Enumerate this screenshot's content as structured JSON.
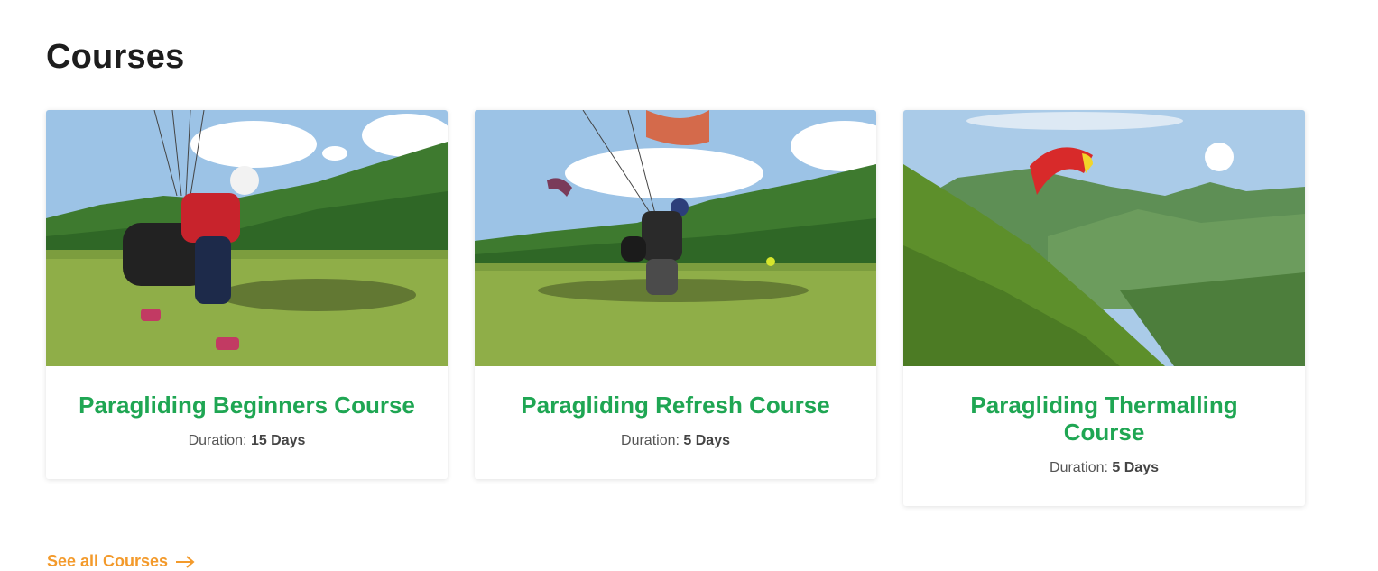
{
  "section": {
    "title": "Courses",
    "see_all_label": "See all Courses",
    "see_all_icon": "arrow-right-icon",
    "accent_color": "#1fa653",
    "link_color": "#f39a2b"
  },
  "courses": [
    {
      "title": "Paragliding Beginners Course",
      "duration_label": "Duration:",
      "duration_value": "15 Days",
      "image": "paraglider-launching-on-field-photo"
    },
    {
      "title": "Paragliding Refresh Course",
      "duration_label": "Duration:",
      "duration_value": "5 Days",
      "image": "paraglider-running-on-field-photo"
    },
    {
      "title": "Paragliding Thermalling Course",
      "duration_label": "Duration:",
      "duration_value": "5 Days",
      "image": "paraglider-over-mountains-photo"
    }
  ]
}
